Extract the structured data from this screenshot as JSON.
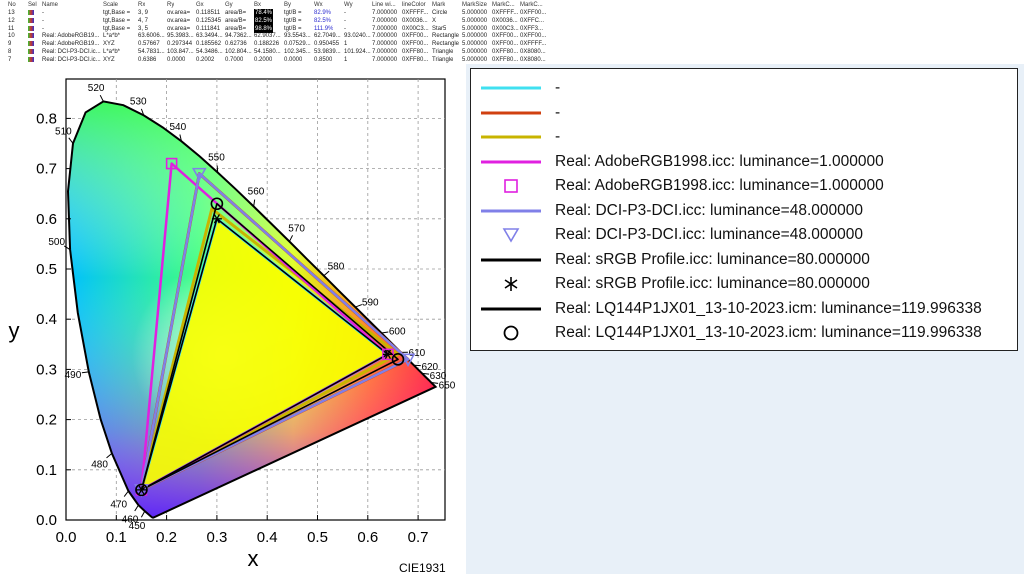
{
  "table": {
    "headers": [
      "No",
      "Sel",
      "Name",
      "Scale",
      "Rx",
      "Ry",
      "Gx",
      "Gy",
      "Bx",
      "By",
      "Wx",
      "Wy",
      "Line wi...",
      "lineColor",
      "Mark",
      "MarkSize",
      "MarkC...",
      "MarkC..."
    ],
    "rows": [
      [
        "13",
        "",
        "-",
        "tgt,Base =",
        "3, 9",
        "ov.area=",
        "0.118511",
        "area/B=",
        "78.4%",
        "tgt/B =",
        "82.9%",
        "-",
        "7.000000",
        "0XFFFF...",
        "Circle",
        "5.000000",
        "0XFFFF...",
        "0XFF00..."
      ],
      [
        "12",
        "",
        "-",
        "tgt,Base =",
        "4, 7",
        "ov.area=",
        "0.125345",
        "area/B=",
        "82.5%",
        "tgt/B =",
        "82.5%",
        "-",
        "7.000000",
        "0X0036...",
        "X",
        "5.000000",
        "0X0036...",
        "0XFFC..."
      ],
      [
        "11",
        "",
        "-",
        "tgt,Base =",
        "3, 5",
        "ov.area=",
        "0.111841",
        "area/B=",
        "98.8%",
        "tgt/B =",
        "111.9%",
        "-",
        "7.000000",
        "0X00C3...",
        "Star5",
        "5.000000",
        "0X00C3...",
        "0XFF3..."
      ],
      [
        "10",
        "",
        "Real: AdobeRGB19...",
        "L*a*b*",
        "63.6006...",
        "95.3983...",
        "63.3494...",
        "94.7362...",
        "62.9037...",
        "93.5543...",
        "62.7049...",
        "93.0240...",
        "7.000000",
        "0XFF00...",
        "Rectangle",
        "5.000000",
        "0XFF00...",
        "0XFF00..."
      ],
      [
        "9",
        "",
        "Real: AdobeRGB19...",
        "XYZ",
        "0.57667",
        "0.297344",
        "0.185562",
        "0.62736",
        "0.188226",
        "0.07529...",
        "0.950455",
        "1",
        "7.000000",
        "0XFF00...",
        "Rectangle",
        "5.000000",
        "0XFF00...",
        "0XFFFF..."
      ],
      [
        "8",
        "",
        "Real: DCI-P3-DCI.ic...",
        "L*a*b*",
        "54.7831...",
        "103.847...",
        "54.3486...",
        "102.804...",
        "54.1580...",
        "102.345...",
        "53.9839...",
        "101.924...",
        "7.000000",
        "0XFF80...",
        "Triangle",
        "5.000000",
        "0XFF80...",
        "0X8080..."
      ],
      [
        "7",
        "",
        "Real: DCI-P3-DCI.ic...",
        "XYZ",
        "0.6386",
        "0.0000",
        "0.2002",
        "0.7000",
        "0.2000",
        "0.0000",
        "0.8500",
        "1",
        "7.000000",
        "0XFF80...",
        "Triangle",
        "5.000000",
        "0XFF80...",
        "0X8080..."
      ]
    ]
  },
  "chart_data": {
    "type": "scatter",
    "title": "",
    "xlabel": "x",
    "ylabel": "y",
    "caption": "CIE1931",
    "xlim": [
      0.0,
      0.77
    ],
    "ylim": [
      0.0,
      0.85
    ],
    "xticks": [
      "0.0",
      "0.1",
      "0.2",
      "0.3",
      "0.4",
      "0.5",
      "0.6",
      "0.7"
    ],
    "yticks": [
      "0.0",
      "0.1",
      "0.2",
      "0.3",
      "0.4",
      "0.5",
      "0.6",
      "0.7",
      "0.8"
    ],
    "grid": true,
    "locus_labels": [
      {
        "nm": "450",
        "x": 0.1566,
        "y": 0.0177
      },
      {
        "nm": "460",
        "x": 0.144,
        "y": 0.0297
      },
      {
        "nm": "470",
        "x": 0.1241,
        "y": 0.0578
      },
      {
        "nm": "480",
        "x": 0.0913,
        "y": 0.1327
      },
      {
        "nm": "490",
        "x": 0.0454,
        "y": 0.295
      },
      {
        "nm": "500",
        "x": 0.0082,
        "y": 0.5384
      },
      {
        "nm": "510",
        "x": 0.0139,
        "y": 0.7502
      },
      {
        "nm": "520",
        "x": 0.0743,
        "y": 0.8338
      },
      {
        "nm": "530",
        "x": 0.1547,
        "y": 0.8059
      },
      {
        "nm": "540",
        "x": 0.2296,
        "y": 0.7543
      },
      {
        "nm": "550",
        "x": 0.3016,
        "y": 0.6923
      },
      {
        "nm": "560",
        "x": 0.3731,
        "y": 0.6245
      },
      {
        "nm": "570",
        "x": 0.4441,
        "y": 0.5547
      },
      {
        "nm": "580",
        "x": 0.5125,
        "y": 0.4866
      },
      {
        "nm": "590",
        "x": 0.5752,
        "y": 0.4242
      },
      {
        "nm": "600",
        "x": 0.627,
        "y": 0.3725
      },
      {
        "nm": "610",
        "x": 0.6658,
        "y": 0.334
      },
      {
        "nm": "620",
        "x": 0.6915,
        "y": 0.3083
      },
      {
        "nm": "630",
        "x": 0.7079,
        "y": 0.292
      },
      {
        "nm": "650",
        "x": 0.726,
        "y": 0.274
      }
    ],
    "series": [
      {
        "name": "-",
        "color": "#40e0f0",
        "points": [
          [
            0.64,
            0.33
          ],
          [
            0.3,
            0.6
          ],
          [
            0.15,
            0.06
          ]
        ]
      },
      {
        "name": "-",
        "color": "#d04010",
        "points": [
          [
            0.68,
            0.32
          ],
          [
            0.265,
            0.69
          ],
          [
            0.15,
            0.06
          ]
        ]
      },
      {
        "name": "-",
        "color": "#c8b400",
        "points": [
          [
            0.66,
            0.33
          ],
          [
            0.29,
            0.62
          ],
          [
            0.15,
            0.06
          ]
        ]
      },
      {
        "name": "Real: AdobeRGB1998.icc: luminance=1.000000",
        "color": "#e020e0",
        "points": [
          [
            0.64,
            0.33
          ],
          [
            0.21,
            0.71
          ],
          [
            0.15,
            0.06
          ]
        ]
      },
      {
        "name": "Real: DCI-P3-DCI.icc: luminance=48.000000",
        "color": "#8080e8",
        "points": [
          [
            0.68,
            0.32
          ],
          [
            0.265,
            0.69
          ],
          [
            0.15,
            0.06
          ]
        ]
      },
      {
        "name": "Real: sRGB Profile.icc: luminance=80.000000",
        "color": "#000000",
        "points": [
          [
            0.64,
            0.33
          ],
          [
            0.3,
            0.6
          ],
          [
            0.15,
            0.06
          ]
        ]
      },
      {
        "name": "Real: LQ144P1JX01_13-10-2023.icm: luminance=119.996338",
        "color": "#000000",
        "points": [
          [
            0.66,
            0.32
          ],
          [
            0.3,
            0.63
          ],
          [
            0.15,
            0.06
          ]
        ]
      }
    ]
  },
  "legend": {
    "items": [
      {
        "label": "-",
        "symbol": "line",
        "color": "#40e0f0"
      },
      {
        "label": "-",
        "symbol": "line",
        "color": "#d04010"
      },
      {
        "label": "-",
        "symbol": "line",
        "color": "#c8b400"
      },
      {
        "label": "Real: AdobeRGB1998.icc: luminance=1.000000",
        "symbol": "line",
        "color": "#e020e0"
      },
      {
        "label": "Real: AdobeRGB1998.icc: luminance=1.000000",
        "symbol": "square",
        "color": "#e020e0"
      },
      {
        "label": "Real: DCI-P3-DCI.icc: luminance=48.000000",
        "symbol": "line",
        "color": "#8080e8"
      },
      {
        "label": "Real: DCI-P3-DCI.icc: luminance=48.000000",
        "symbol": "triangle",
        "color": "#8080e8"
      },
      {
        "label": "Real: sRGB Profile.icc: luminance=80.000000",
        "symbol": "line",
        "color": "#000000"
      },
      {
        "label": "Real: sRGB Profile.icc: luminance=80.000000",
        "symbol": "asterisk",
        "color": "#000000"
      },
      {
        "label": "Real: LQ144P1JX01_13-10-2023.icm: luminance=119.996338",
        "symbol": "line",
        "color": "#000000"
      },
      {
        "label": "Real: LQ144P1JX01_13-10-2023.icm: luminance=119.996338",
        "symbol": "circle",
        "color": "#000000"
      }
    ]
  }
}
